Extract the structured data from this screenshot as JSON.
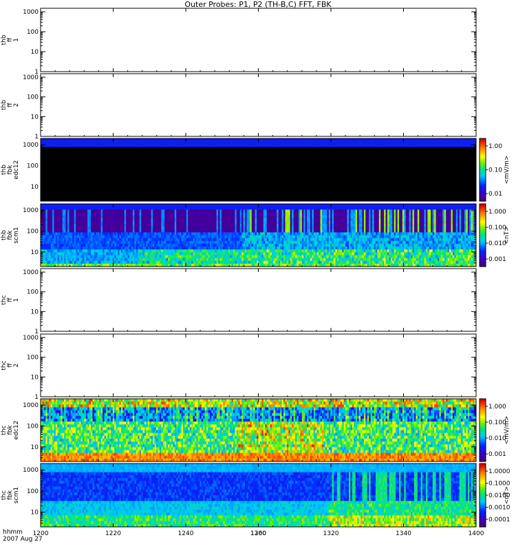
{
  "title": "Outer Probes: P1, P2 (TH-B,C) FFT, FBK",
  "x_axis": {
    "ticks": [
      "1200",
      "1220",
      "1240",
      "1260",
      "1300",
      "1320",
      "1340",
      "1400"
    ],
    "tick_values": [
      1200,
      1220,
      1240,
      1260,
      1300,
      1320,
      1340,
      1400
    ],
    "label_line1": "hhmm",
    "label_line2": "2007 Aug 27"
  },
  "chart_data": [
    {
      "type": "heatmap",
      "ylabel": [
        "thb",
        "ff",
        "1"
      ],
      "yscale": "log",
      "ylim": [
        1,
        1500
      ],
      "yticks": [
        "1000",
        "100",
        "10",
        "1"
      ],
      "empty": true
    },
    {
      "type": "heatmap",
      "ylabel": [
        "thb",
        "ff",
        "2"
      ],
      "yscale": "log",
      "ylim": [
        1,
        1500
      ],
      "yticks": [
        "1000",
        "100",
        "10",
        "1"
      ],
      "empty": true
    },
    {
      "type": "heatmap",
      "ylabel": [
        "thb",
        "fbk",
        "edc12"
      ],
      "yscale": "log",
      "ylim": [
        2,
        2000
      ],
      "yticks": [
        "1000",
        "100",
        "10"
      ],
      "colorbar": {
        "label": "<mV/m>",
        "ticks": [
          "1.00",
          "0.10",
          "0.01"
        ]
      },
      "pattern": "black"
    },
    {
      "type": "heatmap",
      "ylabel": [
        "thb",
        "fbk",
        "scm1"
      ],
      "yscale": "log",
      "ylim": [
        2,
        2000
      ],
      "yticks": [
        "1000",
        "100",
        "10"
      ],
      "colorbar": {
        "label": "<nT>",
        "ticks": [
          "1.000",
          "0.100",
          "0.010",
          "0.001"
        ]
      },
      "pattern": "scm_b"
    },
    {
      "type": "heatmap",
      "ylabel": [
        "thc",
        "ff",
        "1"
      ],
      "yscale": "log",
      "ylim": [
        1,
        1500
      ],
      "yticks": [
        "1000",
        "100",
        "10",
        "1"
      ],
      "empty": true
    },
    {
      "type": "heatmap",
      "ylabel": [
        "thc",
        "ff",
        "2"
      ],
      "yscale": "log",
      "ylim": [
        1,
        1500
      ],
      "yticks": [
        "1000",
        "100",
        "10",
        "1"
      ],
      "empty": true
    },
    {
      "type": "heatmap",
      "ylabel": [
        "thc",
        "fbk",
        "edc12"
      ],
      "yscale": "log",
      "ylim": [
        2,
        2000
      ],
      "yticks": [
        "1000",
        "100",
        "10"
      ],
      "colorbar": {
        "label": "<mV/m>",
        "ticks": [
          "1.000",
          "0.100",
          "0.010",
          "0.001"
        ]
      },
      "pattern": "edc_c"
    },
    {
      "type": "heatmap",
      "ylabel": [
        "thc",
        "fbk",
        "scm1"
      ],
      "yscale": "log",
      "ylim": [
        2,
        2000
      ],
      "yticks": [
        "1000",
        "100",
        "10"
      ],
      "colorbar": {
        "label": "<nT>",
        "ticks": [
          "1.0000",
          "0.1000",
          "0.0100",
          "0.0010",
          "0.0001"
        ]
      },
      "pattern": "scm_c"
    }
  ]
}
